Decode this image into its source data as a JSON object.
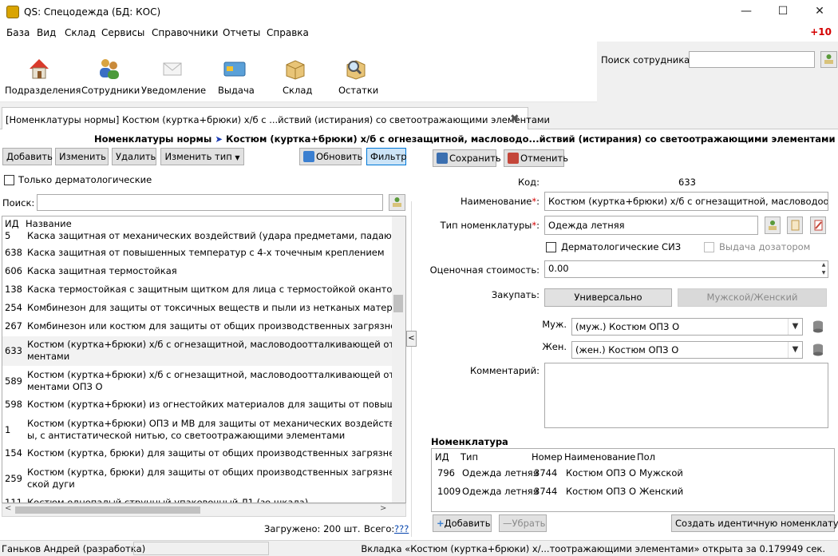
{
  "window": {
    "title": "QS: Спецодежда (БД: КОС)",
    "minimize": "—",
    "maximize": "☐",
    "close": "✕"
  },
  "menu": [
    "База",
    "Вид",
    "Склад",
    "Сервисы",
    "Справочники",
    "Отчеты",
    "Справка"
  ],
  "notification_count": "+10",
  "toolbar": [
    {
      "label": "Подразделения",
      "icon": "house-icon"
    },
    {
      "label": "Сотрудники",
      "icon": "people-icon"
    },
    {
      "label": "Уведомление",
      "icon": "envelope-icon"
    },
    {
      "label": "Выдача",
      "icon": "card-icon"
    },
    {
      "label": "Склад",
      "icon": "box-icon"
    },
    {
      "label": "Остатки",
      "icon": "magnifier-box-icon"
    }
  ],
  "employee_search": {
    "label": "Поиск сотрудника:",
    "value": ""
  },
  "tab": {
    "title": "[Номенклатуры нормы] Костюм  (куртка+брюки) х/б с ...йствий (истирания) со светоотражающими элементами"
  },
  "breadcrumb": {
    "root": "Номенклатуры нормы",
    "arrow": "➤",
    "current": "Костюм  (куртка+брюки) х/б с огнезащитной, масловодо...йствий (истирания) со светоотражающими элементами"
  },
  "left": {
    "buttons": {
      "add": "Добавить",
      "edit": "Изменить",
      "delete": "Удалить",
      "change_type": "Изменить тип",
      "refresh": "Обновить",
      "filter": "Фильтр"
    },
    "derma_only": "Только дерматологические",
    "search_label": "Поиск:",
    "search_value": "",
    "columns": {
      "id": "ИД",
      "name": "Название"
    },
    "rows": [
      {
        "id": "5",
        "name": "Каска защитная от механических воздействий (удара предметами, падающими с в"
      },
      {
        "id": "638",
        "name": "Каска защитная от повышенных температур с 4-х точечным креплением"
      },
      {
        "id": "606",
        "name": "Каска защитная термостойкая"
      },
      {
        "id": "138",
        "name": "Каска термостойкая с защитным щитком для лица с термостойкой окантовкой"
      },
      {
        "id": "254",
        "name": "Комбинезон для защиты от токсичных веществ и пыли из нетканых материалов"
      },
      {
        "id": "267",
        "name": "Комбинезон или костюм для защиты от общих производственных загрязнений и г"
      },
      {
        "id": "633",
        "name": "Костюм  (куртка+брюки) х/б с огнезащитной, масловодоотталкивающей отделкой",
        "name2": "ментами"
      },
      {
        "id": "589",
        "name": "Костюм  (куртка+брюки) х/б с огнезащитной, масловодоотталкивающей отделкой",
        "name2": "ментами ОПЗ О"
      },
      {
        "id": "598",
        "name": "Костюм (куртка+брюки) из огнестойких материалов для защиты от повышенных т"
      },
      {
        "id": "1",
        "name": "Костюм (куртка+брюки) ОПЗ и МВ для защиты от механических воздействий (ист",
        "name2": "ы, с антистатической нитью, со светоотражающими элементами"
      },
      {
        "id": "154",
        "name": "Костюм (куртка, брюки) для защиты от общих производственных загрязнений,  те"
      },
      {
        "id": "259",
        "name": "Костюм (куртка, брюки) для защиты от общих производственных загрязнений, по",
        "name2": "ской дуги"
      },
      {
        "id": "111",
        "name": "Костюм однопалый струнный упаковочный Л1 (зо шкала)"
      }
    ],
    "loaded": "Загружено: 200 шт.",
    "total_label": "Всего:",
    "total_link": "???"
  },
  "right": {
    "save": "Сохранить",
    "cancel": "Отменить",
    "code_label": "Код:",
    "code_value": "633",
    "name_label": "Наименование",
    "name_value": "Костюм  (куртка+брюки) х/б с огнезащитной, масловодоотталк",
    "type_label": "Тип номенклатуры",
    "type_value": "Одежда летняя",
    "derma_label": "Дерматологические СИЗ",
    "dispenser_label": "Выдача дозатором",
    "price_label": "Оценочная стоимость:",
    "price_value": "0.00",
    "purchase_label": "Закупать:",
    "universal": "Универсально",
    "male_female": "Мужской/Женский",
    "male_label": "Муж.",
    "male_value": "(муж.) Костюм ОПЗ О",
    "female_label": "Жен.",
    "female_value": "(жен.) Костюм ОПЗ О",
    "comment_label": "Комментарий:",
    "comment_value": "",
    "nomenclature_title": "Номенклатура",
    "nom_columns": [
      "ИД",
      "Тип",
      "Номер",
      "Наименование",
      "Пол"
    ],
    "nom_rows": [
      [
        "796",
        "Одежда летняя",
        "3744",
        "Костюм ОПЗ О",
        "Мужской"
      ],
      [
        "1009",
        "Одежда летняя",
        "3744",
        "Костюм ОПЗ О",
        "Женский"
      ]
    ],
    "add": "Добавить",
    "remove": "Убрать",
    "create_identical": "Создать идентичную номенклатуру"
  },
  "status": {
    "user": "Ганьков Андрей (разработка)",
    "message": "Вкладка «Костюм  (куртка+брюки) х/...тоотражающими элементами» открыта за 0.179949 сек."
  },
  "colors": {
    "accent": "#0078d7",
    "required": "#d40000",
    "arrow": "#1a3bb3"
  }
}
